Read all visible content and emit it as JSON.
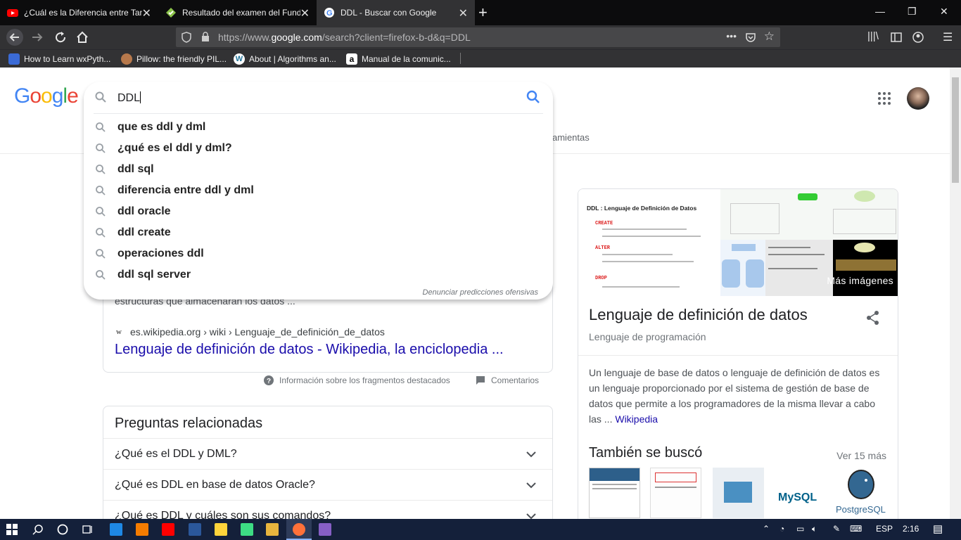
{
  "browser": {
    "tabs": [
      {
        "title": "¿Cuál es la Diferencia entre Tan",
        "favicon": "youtube-icon",
        "active": false
      },
      {
        "title": "Resultado del examen del Fund",
        "favicon": "check-icon",
        "active": false
      },
      {
        "title": "DDL - Buscar con Google",
        "favicon": "google-icon",
        "active": true
      }
    ],
    "url_prefix": "https://www.",
    "url_domain": "google.com",
    "url_suffix": "/search?client=firefox-b-d&q=DDL",
    "bookmarks": [
      {
        "label": "How to Learn wxPyth...",
        "icon": "wx-icon"
      },
      {
        "label": "Pillow: the friendly PIL...",
        "icon": "pillow-icon"
      },
      {
        "label": "About | Algorithms an...",
        "icon": "wordpress-icon"
      },
      {
        "label": "Manual de la comunic...",
        "icon": "amazon-icon"
      }
    ]
  },
  "google": {
    "logo": "Google",
    "query": "DDL",
    "suggestions": [
      "que es ddl y dml",
      "¿qué es el ddl y dml?",
      "ddl sql",
      "diferencia entre ddl y dml",
      "ddl oracle",
      "ddl create",
      "operaciones ddl",
      "ddl sql server"
    ],
    "report_text": "Denunciar predicciones ofensivas",
    "tools_partial": "amientas"
  },
  "snippet": {
    "text": "estructuras que almacenarán los datos ...",
    "wiki_logo": "W",
    "source": "es.wikipedia.org › wiki › Lenguaje_de_definición_de_datos",
    "title": "Lenguaje de definición de datos - Wikipedia, la enciclopedia ...",
    "info_label": "Información sobre los fragmentos destacados",
    "comments_label": "Comentarios"
  },
  "paa": {
    "title": "Preguntas relacionadas",
    "questions": [
      "¿Qué es el DDL y DML?",
      "¿Qué es DDL en base de datos Oracle?",
      "¿Qué es DDL y cuáles son sus comandos?"
    ]
  },
  "knowledge": {
    "img_heading": "DDL : Lenguaje de Definición de Datos",
    "img_create": "CREATE",
    "img_alter": "ALTER",
    "img_drop": "DROP",
    "more_images": "Más imágenes",
    "title": "Lenguaje de definición de datos",
    "subtitle": "Lenguaje de programación",
    "description": "Un lenguaje de base de datos o lenguaje de definición de datos es un lenguaje proporcionado por el sistema de gestión de base de datos que permite a los programadores de la misma llevar a cabo las ...",
    "desc_link": "Wikipedia",
    "also_searched": "También se buscó",
    "see_more": "Ver 15 más",
    "mysql": "MySQL",
    "postgres": "PostgreSQL"
  },
  "taskbar": {
    "lang": "ESP",
    "time": "2:16"
  }
}
